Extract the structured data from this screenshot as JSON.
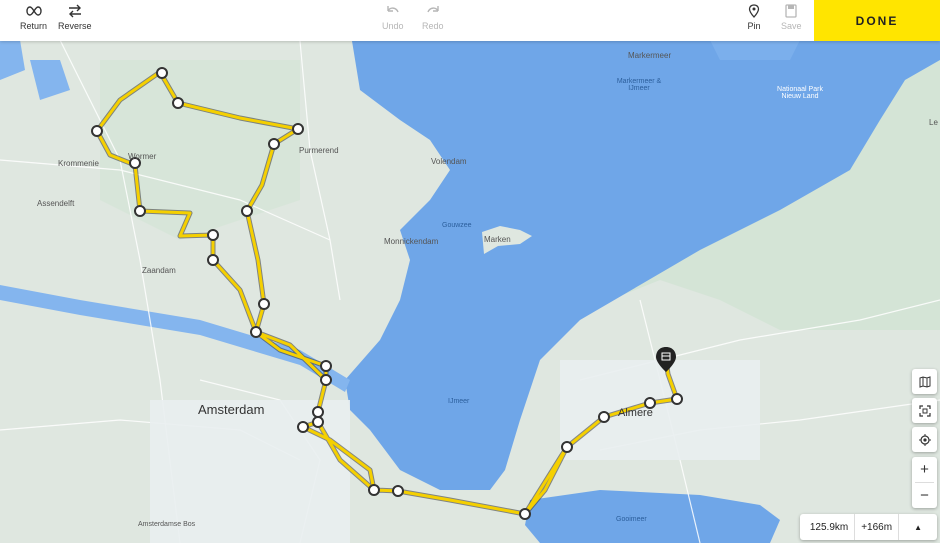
{
  "toolbar": {
    "return_label": "Return",
    "reverse_label": "Reverse",
    "undo_label": "Undo",
    "redo_label": "Redo",
    "pin_label": "Pin",
    "save_label": "Save",
    "done_label": "DONE"
  },
  "map_labels": {
    "markermeer": "Markermeer",
    "markermeer_dimmer": "Markermeer & IJmeer",
    "national_park": "Nationaal Park Nieuw Land",
    "purmerend": "Purmerend",
    "volendam": "Volendam",
    "krommenie": "Krommenie",
    "assendelft": "Assendelft",
    "gouwzee": "Gouwzee",
    "marken": "Marken",
    "monnickendam": "Monnickendam",
    "zaandam": "Zaandam",
    "amsterdam": "Amsterdam",
    "ijmeer": "IJmeer",
    "almere": "Almere",
    "gooimeer": "Gooimeer",
    "wormer": "Wormer",
    "amsterdamse_bos": "Amsterdamse Bos",
    "edge_le": "Le"
  },
  "status": {
    "distance": "125.9km",
    "elevation": "+166m"
  },
  "colors": {
    "route": "#f5d000",
    "water": "#6fa6e8",
    "land": "#dfe7e0",
    "done_button": "#ffe500"
  }
}
